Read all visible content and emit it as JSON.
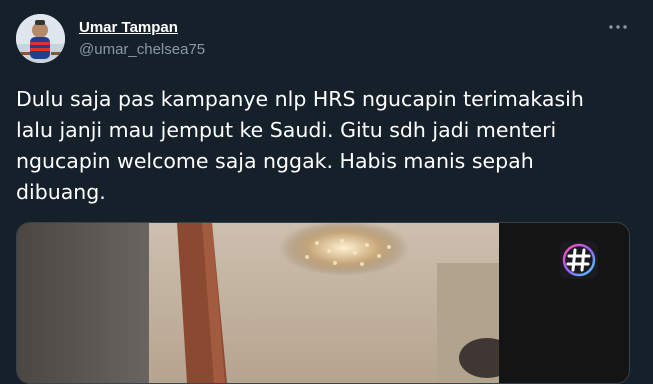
{
  "author": {
    "display_name": "Umar Tampan",
    "handle": "@umar_chelsea75",
    "avatar_icon": "profile-photo"
  },
  "more_icon": "more-options-icon",
  "tweet": {
    "text": "Dulu saja pas kampanye nlp HRS ngucapin terimakasih\nlalu janji mau jemput ke Saudi. Gitu sdh jadi menteri\nngucapin welcome saja nggak. Habis manis sepah\ndibuang."
  },
  "media": {
    "kind": "video-thumbnail",
    "overlay_badge_icon": "hashtag-logo-icon"
  },
  "colors": {
    "background": "#15202b",
    "secondary_text": "#8899a6",
    "border": "#38444d"
  }
}
